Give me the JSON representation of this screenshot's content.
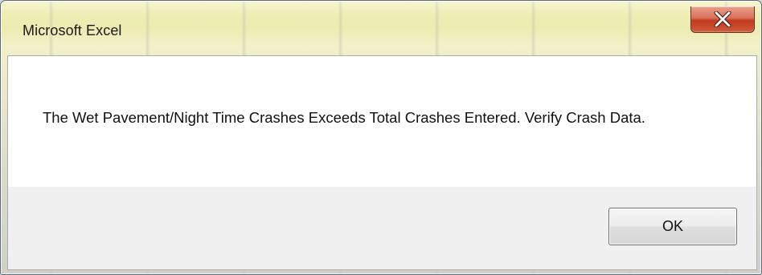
{
  "window": {
    "title": "Microsoft Excel",
    "close_icon": "close-icon"
  },
  "dialog": {
    "message": "The Wet Pavement/Night Time Crashes Exceeds Total Crashes Entered. Verify Crash Data.",
    "ok_label": "OK"
  },
  "colors": {
    "close_button": "#c2391c",
    "client_background": "#ffffff",
    "footer_background": "#f0f0f0"
  }
}
